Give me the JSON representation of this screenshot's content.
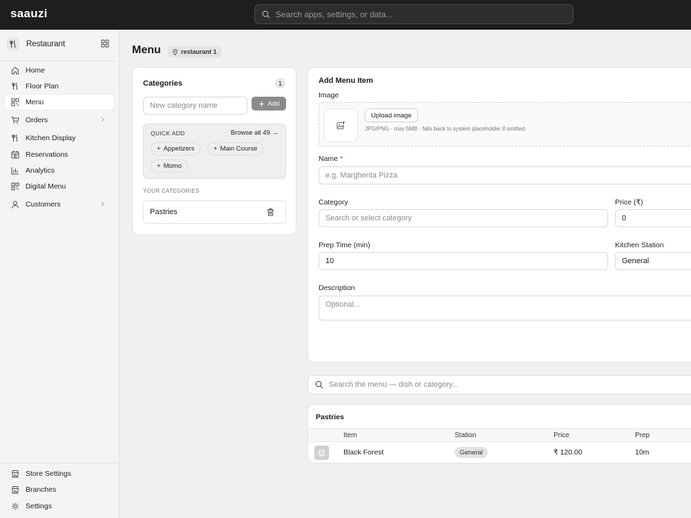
{
  "app": {
    "brand": "saauzi",
    "search_placeholder": "Search apps, settings, or data..."
  },
  "sidebar": {
    "store_name": "Restaurant",
    "items": [
      {
        "label": "Home",
        "icon": "home-icon"
      },
      {
        "label": "Floor Plan",
        "icon": "utensils-icon"
      },
      {
        "label": "Menu",
        "icon": "qr-icon",
        "active": true
      },
      {
        "label": "Orders",
        "icon": "cart-icon",
        "has_children": true
      },
      {
        "label": "Kitchen Display",
        "icon": "utensils-icon"
      },
      {
        "label": "Reservations",
        "icon": "calendar-icon"
      },
      {
        "label": "Analytics",
        "icon": "bar-chart-icon"
      },
      {
        "label": "Digital Menu",
        "icon": "qr-icon"
      },
      {
        "label": "Customers",
        "icon": "user-icon",
        "has_children": true
      }
    ],
    "bottom_items": [
      {
        "label": "Store Settings",
        "icon": "store-icon"
      },
      {
        "label": "Branches",
        "icon": "store-icon"
      },
      {
        "label": "Settings",
        "icon": "gear-icon"
      }
    ]
  },
  "page": {
    "title": "Menu",
    "location_badge": "restaurant 1"
  },
  "categories": {
    "title": "Categories",
    "count": "1",
    "new_placeholder": "New category name",
    "add_label": "Add",
    "quick_add_title": "QUICK ADD",
    "browse_all": "Browse all 49 →",
    "quick_chips": [
      "Appetizers",
      "Main Course",
      "Momo"
    ],
    "your_title": "YOUR CATEGORIES",
    "list": [
      "Pastries"
    ]
  },
  "form": {
    "title": "Add Menu Item",
    "image_label": "Image",
    "upload_label": "Upload image",
    "image_hint": "JPG/PNG · max 5MB · falls back to system placeholder if omitted.",
    "name_label": "Name",
    "required_mark": "*",
    "name_placeholder": "e.g. Margherita Pizza",
    "category_label": "Category",
    "category_placeholder": "Search or select category",
    "price_label": "Price (₹)",
    "price_value": "0",
    "prep_label": "Prep Time (min)",
    "prep_value": "10",
    "station_label": "Kitchen Station",
    "station_value": "General",
    "description_label": "Description",
    "description_placeholder": "Optional..."
  },
  "menu_search": {
    "placeholder": "Search the menu — dish or category..."
  },
  "table": {
    "group_title": "Pastries",
    "headers": [
      "Item",
      "Station",
      "Price",
      "Prep"
    ],
    "rows": [
      {
        "item": "Black Forest",
        "station": "General",
        "price": "₹ 120.00",
        "prep": "10m"
      }
    ]
  },
  "colors": {
    "topbar": "#1e1e1e",
    "accent_gray": "#8b8b8b",
    "required": "#d0302f"
  }
}
